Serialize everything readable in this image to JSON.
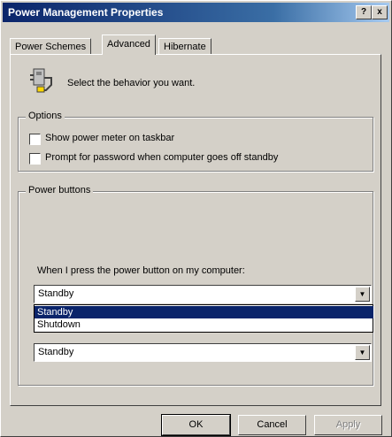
{
  "window": {
    "title": "Power Management Properties",
    "help_button": "?",
    "close_button": "x"
  },
  "tabs": [
    {
      "label": "Power Schemes",
      "active": false
    },
    {
      "label": "Advanced",
      "active": true
    },
    {
      "label": "Hibernate",
      "active": false
    }
  ],
  "header": {
    "text": "Select the behavior you want."
  },
  "options": {
    "legend": "Options",
    "show_icon_label": "Show power meter on taskbar",
    "show_icon_checked": false,
    "prompt_password_label": "Prompt for password when computer goes off standby",
    "prompt_password_checked": false
  },
  "power_buttons": {
    "legend": "Power buttons",
    "power_button_prompt": "When I press the power button on my computer:",
    "power_button_value": "Standby",
    "list_options": [
      "Standby",
      "Shutdown"
    ],
    "sleep_button_value": "Standby"
  },
  "buttons": {
    "ok": "OK",
    "cancel": "Cancel",
    "apply": "Apply"
  },
  "colors": {
    "titlebar": "#0a246a",
    "selection": "#0a246a",
    "face": "#d4d0c8"
  }
}
